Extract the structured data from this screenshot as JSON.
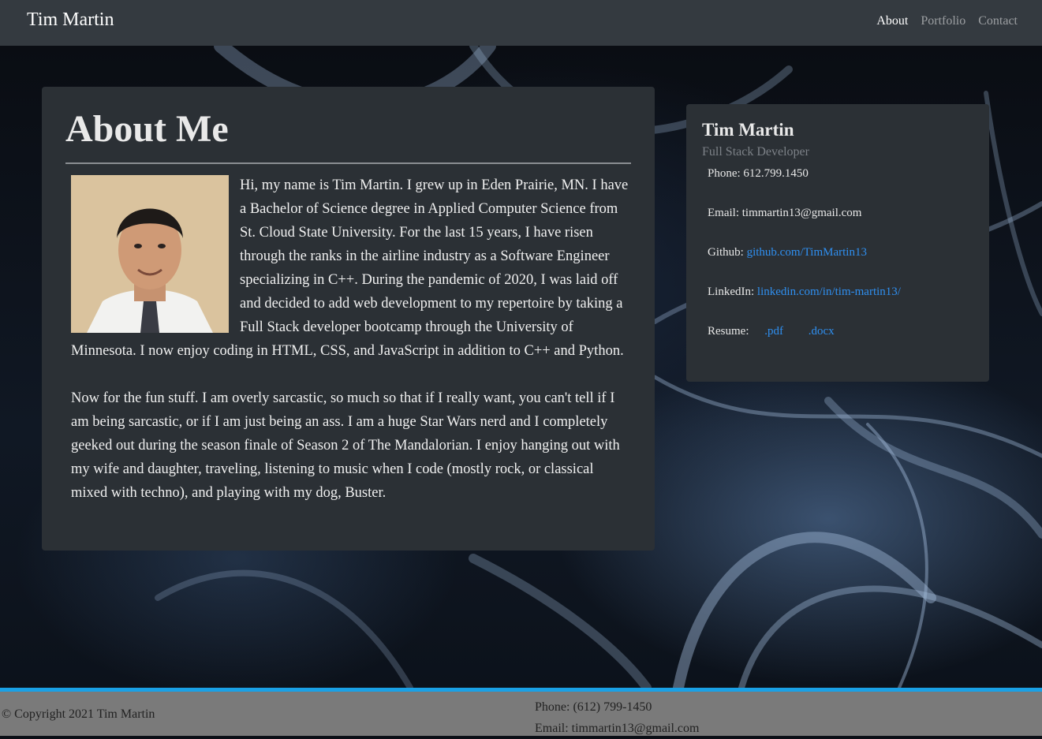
{
  "navbar": {
    "brand": "Tim Martin",
    "links": [
      {
        "label": "About",
        "active": true
      },
      {
        "label": "Portfolio",
        "active": false
      },
      {
        "label": "Contact",
        "active": false
      }
    ]
  },
  "about": {
    "title": "About Me",
    "paragraphs": [
      "Hi, my name is Tim Martin. I grew up in Eden Prairie, MN. I have a Bachelor of Science degree in Applied Computer Science from St. Cloud State University. For the last 15 years, I have risen through the ranks in the airline industry as a Software Engineer specializing in C++. During the pandemic of 2020, I was laid off and decided to add web development to my repertoire by taking a Full Stack developer bootcamp through the University of Minnesota. I now enjoy coding in HTML, CSS, and JavaScript in addition to C++ and Python.",
      "Now for the fun stuff. I am overly sarcastic, so much so that if I really want, you can't tell if I am being sarcastic, or if I am just being an ass. I am a huge Star Wars nerd and I completely geeked out during the season finale of Season 2 of The Mandalorian. I enjoy hanging out with my wife and daughter, traveling, listening to music when I code (mostly rock, or classical mixed with techno), and playing with my dog, Buster."
    ]
  },
  "contact_card": {
    "name": "Tim Martin",
    "subtitle": "Full Stack Developer",
    "phone_label": "Phone:",
    "phone": "612.799.1450",
    "email_label": "Email:",
    "email": "timmartin13@gmail.com",
    "github_label": "Github:",
    "github": "github.com/TimMartin13",
    "linkedin_label": "LinkedIn:",
    "linkedin": "linkedin.com/in/tim-martin13/",
    "resume_label": "Resume:",
    "resume_pdf": ".pdf",
    "resume_docx": ".docx"
  },
  "footer": {
    "copyright": "© Copyright 2021 Tim Martin",
    "phone": "Phone: (612) 799-1450",
    "email": "Email: timmartin13@gmail.com"
  },
  "colors": {
    "navbar": "#343a40",
    "card": "#2b3035",
    "link": "#2f8ff0",
    "footer": "#7a7a7a",
    "footer_accent": "#1aa1e6"
  }
}
